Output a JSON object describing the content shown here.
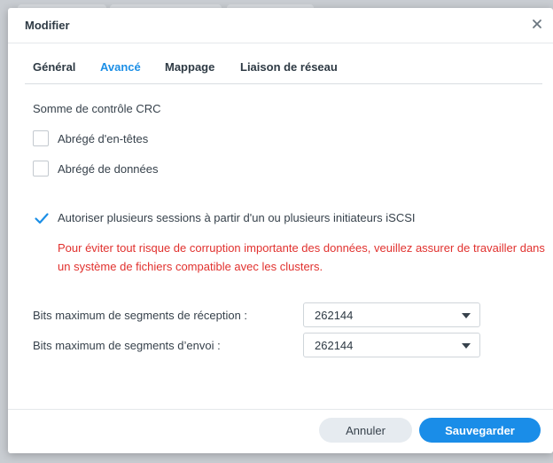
{
  "dialog": {
    "title": "Modifier"
  },
  "tabs": [
    {
      "label": "Général",
      "active": false
    },
    {
      "label": "Avancé",
      "active": true
    },
    {
      "label": "Mappage",
      "active": false
    },
    {
      "label": "Liaison de réseau",
      "active": false
    }
  ],
  "crc": {
    "section_label": "Somme de contrôle CRC",
    "header_digest": {
      "label": "Abrégé d'en-têtes",
      "checked": false
    },
    "data_digest": {
      "label": "Abrégé de données",
      "checked": false
    }
  },
  "multi_session": {
    "label": "Autoriser plusieurs sessions à partir d'un ou plusieurs initiateurs iSCSI",
    "checked": true,
    "warning": "Pour éviter tout risque de corruption importante des données, veuillez assurer de travailler dans un système de fichiers compatible avec les clusters."
  },
  "segments": {
    "receive_label": "Bits maximum de segments de réception :",
    "receive_value": "262144",
    "send_label": "Bits maximum de segments d’envoi :",
    "send_value": "262144"
  },
  "footer": {
    "cancel_label": "Annuler",
    "save_label": "Sauvegarder"
  },
  "colors": {
    "accent": "#1c8fe6",
    "warning": "#e1312e",
    "save_button": "#1a8de8"
  },
  "icons": {
    "close": "close-icon",
    "checkmark": "checkmark-icon",
    "dropdown": "caret-down-icon"
  }
}
